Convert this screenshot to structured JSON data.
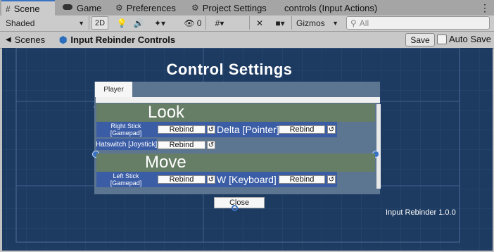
{
  "tabs": [
    {
      "label": "Scene",
      "icon": "grid-icon"
    },
    {
      "label": "Game",
      "icon": "gamepad-icon"
    },
    {
      "label": "Preferences",
      "icon": "gear-icon"
    },
    {
      "label": "Project Settings",
      "icon": "gear-icon"
    },
    {
      "label": "controls (Input Actions)",
      "icon": ""
    }
  ],
  "tab_menu_glyph": "⋮",
  "toolbar": {
    "shading_mode": "Shaded",
    "view_2d": "2D",
    "hidden_count": "0",
    "gizmos": "Gizmos",
    "search_placeholder": "All"
  },
  "breadcrumb": {
    "root": "Scenes",
    "current": "Input Rebinder Controls"
  },
  "prefab_bar": {
    "save_label": "Save",
    "auto_save_label": "Auto Save",
    "auto_save_checked": false
  },
  "scene": {
    "title": "Control Settings",
    "tab_label": "Player",
    "version_label": "Input Rebinder 1.0.0",
    "close_label": "Close",
    "sections": [
      {
        "header": "Look",
        "rows": [
          {
            "binding": "Right Stick\n[Gamepad]",
            "rebind": "Rebind",
            "binding2": "Delta [Pointer]",
            "rebind2": "Rebind"
          },
          {
            "binding": "Hatswitch [Joystick]",
            "rebind": "Rebind"
          }
        ]
      },
      {
        "header": "Move",
        "rows": [
          {
            "binding": "Left Stick\n[Gamepad]",
            "rebind": "Rebind",
            "binding2": "W [Keyboard]",
            "rebind2": "Rebind"
          }
        ]
      }
    ]
  },
  "colors": {
    "scene_bg": "#1d3a61",
    "panel": "#5c7591",
    "header": "#667d66",
    "binding_row": "#3b5da6",
    "selection": "#3a72c4"
  }
}
